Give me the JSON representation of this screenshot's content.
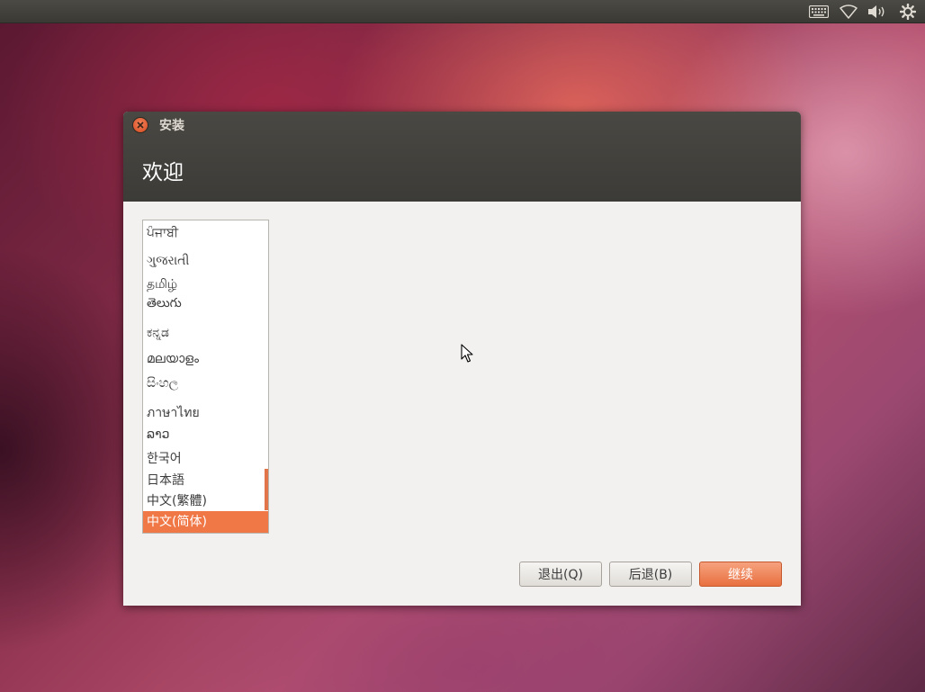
{
  "panel": {
    "icons": [
      "keyboard-icon",
      "wifi-icon",
      "volume-icon",
      "power-gear-icon"
    ]
  },
  "window": {
    "title": "安装",
    "heading": "欢迎"
  },
  "languages": {
    "items": [
      {
        "label": "ਪੰਜਾਬੀ"
      },
      {
        "label": "ગુજરાતી"
      },
      {
        "label": "தமிழ்"
      },
      {
        "label": "తెలుగు"
      },
      {
        "label": "ಕನ್ನಡ"
      },
      {
        "label": "മലയാളം"
      },
      {
        "label": "සිංහල"
      },
      {
        "label": "ภาษาไทย"
      },
      {
        "label": "ລາວ"
      },
      {
        "label": "한국어"
      },
      {
        "label": "日本語"
      },
      {
        "label": "中文(繁體)"
      },
      {
        "label": "中文(简体)",
        "selected": true
      }
    ]
  },
  "buttons": {
    "quit": "退出(Q)",
    "back": "后退(B)",
    "continue": "继续"
  },
  "colors": {
    "accent": "#f07746",
    "titlebar": "#3c3b37",
    "window_bg": "#f2f1f0"
  }
}
